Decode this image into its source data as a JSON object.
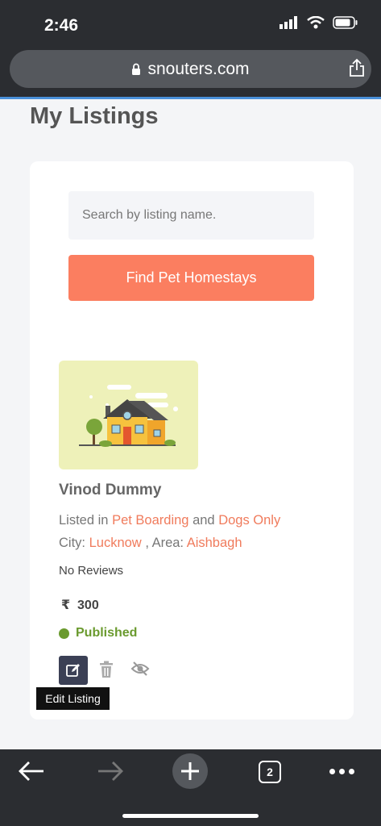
{
  "status_bar": {
    "time": "2:46"
  },
  "browser": {
    "url": "snouters.com",
    "tab_count": "2",
    "load_progress_pct": 100
  },
  "page": {
    "title": "My Listings"
  },
  "search": {
    "placeholder": "Search by listing name.",
    "button_label": "Find Pet Homestays"
  },
  "listing": {
    "name": "Vinod Dummy",
    "listed_in_prefix": "Listed in",
    "category": "Pet Boarding",
    "and_text": "and",
    "subcategory": "Dogs Only",
    "city_label": "City:",
    "city": "Lucknow",
    "area_sep": ", Area:",
    "area": "Aishbagh",
    "reviews": "No Reviews",
    "currency": "₹",
    "price": "300",
    "status": "Published",
    "status_color": "#6a9a2e"
  },
  "actions": {
    "tooltip": "Edit Listing"
  },
  "colors": {
    "accent": "#fb7e60",
    "link": "#f07b5c",
    "chrome": "#2b2d31"
  },
  "icons": [
    "lock-icon",
    "share-icon",
    "edit-icon",
    "trash-icon",
    "eye-off-icon",
    "back-icon",
    "forward-icon",
    "plus-icon",
    "more-icon"
  ]
}
